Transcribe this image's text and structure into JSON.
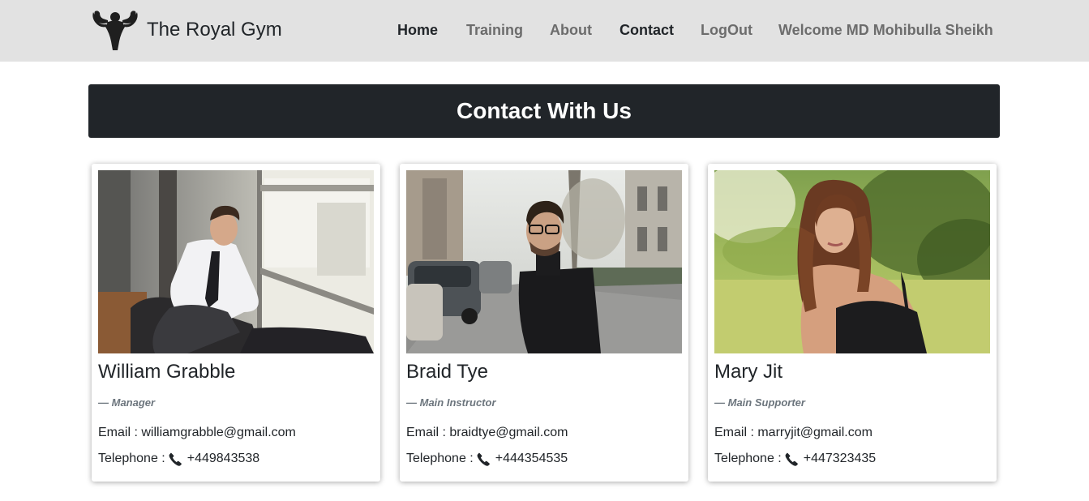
{
  "brand": {
    "name": "The Royal Gym",
    "logo_icon": "muscle-man-icon"
  },
  "nav": {
    "items": [
      {
        "label": "Home",
        "active": true
      },
      {
        "label": "Training",
        "active": false
      },
      {
        "label": "About",
        "active": false
      },
      {
        "label": "Contact",
        "active": true
      },
      {
        "label": "LogOut",
        "active": false
      },
      {
        "label": "Welcome MD Mohibulla Sheikh",
        "active": false
      }
    ]
  },
  "banner": {
    "title": "Contact With Us"
  },
  "contacts": [
    {
      "name": "William Grabble",
      "role": "— Manager",
      "email": "Email : williamgrabble@gmail.com",
      "tel_label": "Telephone :",
      "tel_number": "+449843538",
      "photo": "man-in-suit-photo"
    },
    {
      "name": "Braid Tye",
      "role": "— Main Instructor",
      "email": "Email : braidtye@gmail.com",
      "tel_label": "Telephone :",
      "tel_number": "+444354535",
      "photo": "man-in-turtleneck-photo"
    },
    {
      "name": "Mary Jit",
      "role": "— Main Supporter",
      "email": "Email : marryjit@gmail.com",
      "tel_label": "Telephone :",
      "tel_number": "+447323435",
      "photo": "woman-outdoors-photo"
    }
  ],
  "colors": {
    "navbar_bg": "#e2e2e2",
    "banner_bg": "#212529",
    "active_link": "#212529",
    "muted_link": "#6c6c6c"
  }
}
